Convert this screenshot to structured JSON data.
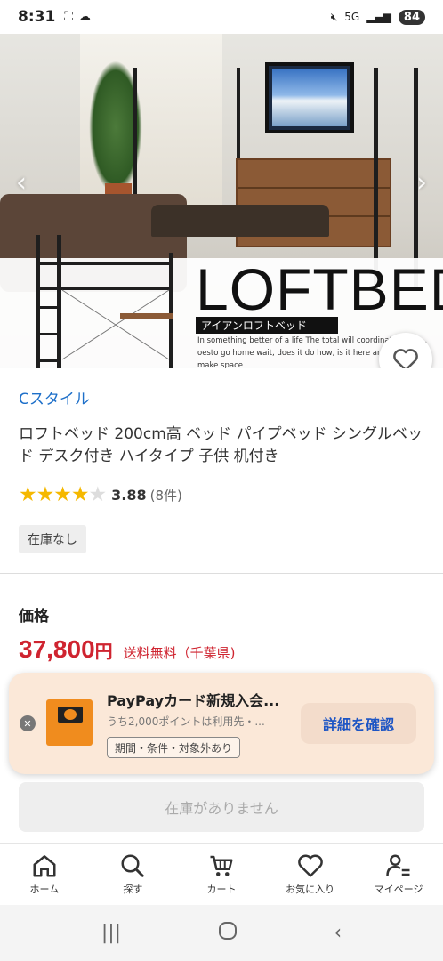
{
  "status_bar": {
    "time": "8:31",
    "network": "5G",
    "battery": "84",
    "icons": [
      "screenshot-icon",
      "cloud-icon",
      "mute-icon",
      "signal-icon"
    ]
  },
  "hero": {
    "banner_title": "LOFTBED",
    "banner_subtitle": "アイアンロフトベッド",
    "banner_caption": "In something better of a life The total will coordinate all ho... oesto go home wait, does it do how, is it here anddoesn't it make space"
  },
  "product": {
    "store_name": "Cスタイル",
    "title": "ロフトベッド 200cm高 ベッド パイプベッド シングルベッド デスク付き ハイタイプ 子供 机付き",
    "rating_value": 3.88,
    "rating_score": "3.88",
    "rating_count": "(8件)",
    "stock_status": "在庫なし"
  },
  "price": {
    "label": "価格",
    "value": "37,800",
    "currency": "円",
    "shipping": "送料無料（千葉県)"
  },
  "promo": {
    "title": "PayPayカード新規入会...",
    "subtitle": "うち2,000ポイントは利用先・...",
    "terms": "期間・条件・対象外あり",
    "cta": "詳細を確認"
  },
  "purchase": {
    "sold_out_label": "在庫がありません"
  },
  "bottom_nav": {
    "items": [
      {
        "label": "ホーム",
        "icon": "home-icon"
      },
      {
        "label": "探す",
        "icon": "search-icon"
      },
      {
        "label": "カート",
        "icon": "cart-icon"
      },
      {
        "label": "お気に入り",
        "icon": "heart-icon"
      },
      {
        "label": "マイページ",
        "icon": "user-icon"
      }
    ]
  },
  "colors": {
    "price_red": "#cf2430",
    "link_blue": "#1d6fc9",
    "star_gold": "#f5b800",
    "promo_bg": "#fbe8d8"
  }
}
